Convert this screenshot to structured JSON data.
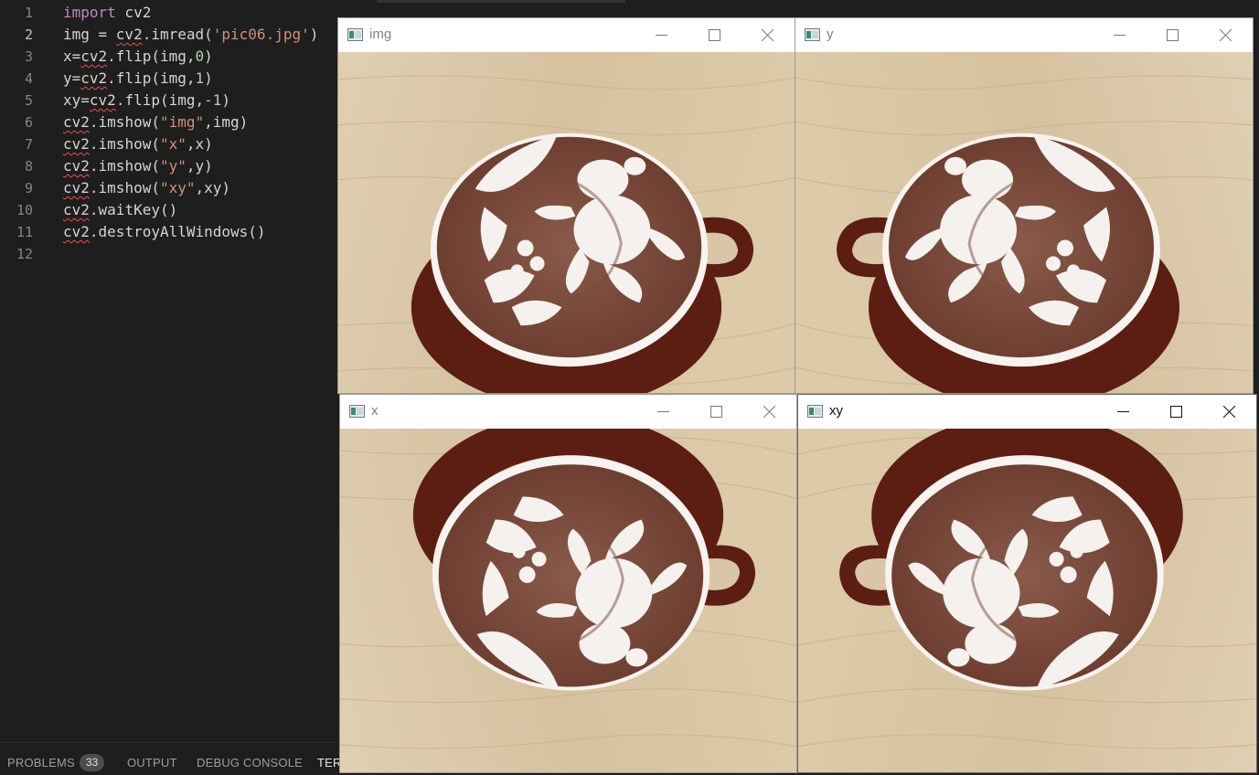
{
  "editor": {
    "active_line": 2,
    "lines": [
      {
        "n": "1"
      },
      {
        "n": "2"
      },
      {
        "n": "3"
      },
      {
        "n": "4"
      },
      {
        "n": "5"
      },
      {
        "n": "6"
      },
      {
        "n": "7"
      },
      {
        "n": "8"
      },
      {
        "n": "9"
      },
      {
        "n": "10"
      },
      {
        "n": "11"
      },
      {
        "n": "12"
      }
    ],
    "code": {
      "l1": {
        "kw": "import",
        "rest": " cv2"
      },
      "l2": {
        "a": "img = ",
        "b": "cv2",
        "c": ".imread(",
        "s": "'pic06.jpg'",
        "d": ")"
      },
      "l3": {
        "a": "x=",
        "b": "cv2",
        "c": ".flip(img,",
        "n": "0",
        "d": ")"
      },
      "l4": {
        "a": "y=",
        "b": "cv2",
        "c": ".flip(img,",
        "n": "1",
        "d": ")"
      },
      "l5": {
        "a": "xy=",
        "b": "cv2",
        "c": ".flip(img,",
        "n": "-1",
        "d": ")"
      },
      "l6": {
        "b": "cv2",
        "c": ".imshow(",
        "s": "\"img\"",
        "d": ",img)"
      },
      "l7": {
        "b": "cv2",
        "c": ".imshow(",
        "s": "\"x\"",
        "d": ",x)"
      },
      "l8": {
        "b": "cv2",
        "c": ".imshow(",
        "s": "\"y\"",
        "d": ",y)"
      },
      "l9": {
        "b": "cv2",
        "c": ".imshow(",
        "s": "\"xy\"",
        "d": ",xy)"
      },
      "l10": {
        "b": "cv2",
        "c": ".waitKey()"
      },
      "l11": {
        "b": "cv2",
        "c": ".destroyAllWindows()"
      }
    }
  },
  "panel": {
    "problems_label": "PROBLEMS",
    "problems_count": "33",
    "output_label": "OUTPUT",
    "debug_label": "DEBUG CONSOLE",
    "terminal_label": "TER"
  },
  "windows": {
    "img": {
      "title": "img",
      "flip": "none"
    },
    "y": {
      "title": "y",
      "flip": "horizontal"
    },
    "x": {
      "title": "x",
      "flip": "vertical"
    },
    "xy": {
      "title": "xy",
      "flip": "both"
    }
  },
  "colors": {
    "editor_bg": "#1e1e1e",
    "keyword": "#c586c0",
    "string": "#ce9178",
    "number": "#b5cea8",
    "wood": "#d8c6a6",
    "cup": "#6b2418",
    "cocoa": "#7a4a3c",
    "foam": "#f4f1ee"
  }
}
